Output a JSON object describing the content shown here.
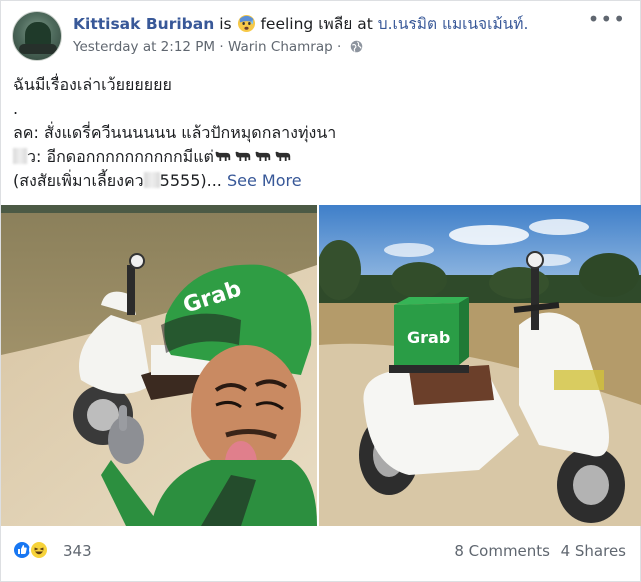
{
  "post": {
    "author": "Kittisak Buriban",
    "is_word": "is",
    "feeling_prefix": "feeling",
    "feeling": "เพลีย",
    "at_word": "at",
    "place": "บ.เนรมิต แมเนจเม้นท์.",
    "timestamp": "Yesterday at 2:12 PM",
    "separator": "·",
    "location": "Warin Chamrap",
    "privacy_icon": "globe-icon",
    "menu_icon": "more-icon",
    "more_glyph": "•••"
  },
  "text": {
    "line1": "ฉันมีเรื่องเล่าเว้ยยยยยย",
    "line2": ".",
    "line3": "ลค: สั่งแดรี่ควีนนนนนน แล้วปักหมุดกลางทุ่งนา",
    "line4_prefix": "ว:",
    "line4_main": "อีกดอกกกกกกกกกกมีแต่",
    "line5_main": "(สงสัยเพิ่มาเลี้ยงคว",
    "line5_suffix": "5555)...",
    "see_more": "See More"
  },
  "footer": {
    "reaction_icons": [
      "like-icon",
      "haha-icon"
    ],
    "reaction_count": "343",
    "comments": "8 Comments",
    "shares": "4 Shares"
  },
  "colors": {
    "link": "#385898",
    "meta": "#606770",
    "like": "#1877f2",
    "grab_green": "#2a9d46"
  }
}
